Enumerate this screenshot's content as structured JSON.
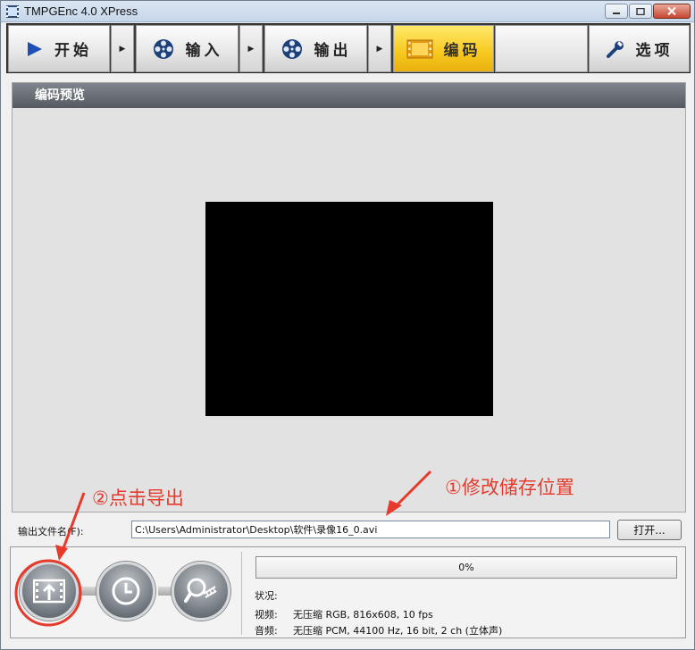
{
  "window": {
    "title": "TMPGEnc 4.0 XPress"
  },
  "nav": {
    "start": "开始",
    "input": "输入",
    "output": "输出",
    "encode": "编码",
    "options": "选项"
  },
  "preview": {
    "header": "编码预览"
  },
  "output_file": {
    "label": "输出文件名(F):",
    "value": "C:\\Users\\Administrator\\Desktop\\软件\\录像16_0.avi",
    "open_button": "打开..."
  },
  "progress": {
    "percent_text": "0%",
    "value": 0
  },
  "status": {
    "status_label": "状况:",
    "video_label": "视频:",
    "video_value": "无压缩 RGB, 816x608, 10 fps",
    "audio_label": "音频:",
    "audio_value": "无压缩 PCM, 44100 Hz, 16 bit, 2 ch (立体声)"
  },
  "annotations": {
    "step1": "①修改储存位置",
    "step2": "②点击导出"
  },
  "colors": {
    "accent_active": "#f7c81e",
    "annotation_red": "#e53a2c"
  }
}
